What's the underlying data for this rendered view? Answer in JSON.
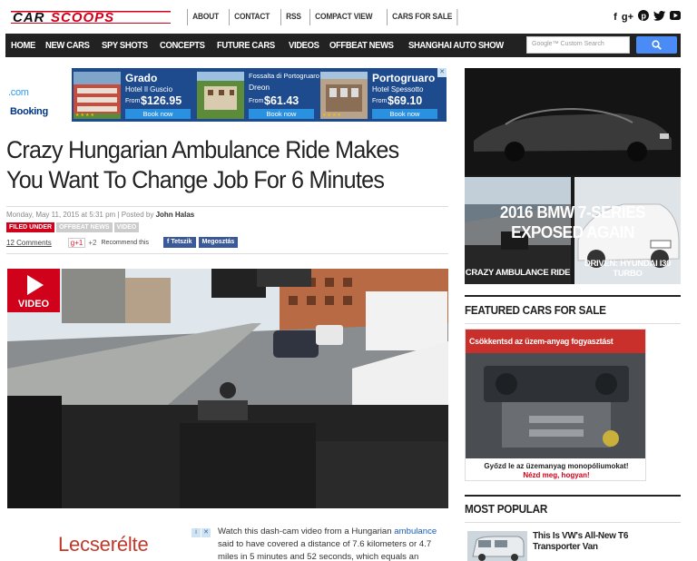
{
  "brand": {
    "name": "CARSCOOPS"
  },
  "toplinks": [
    "ABOUT",
    "CONTACT",
    "RSS",
    "COMPACT VIEW",
    "CARS FOR SALE"
  ],
  "social": [
    "f",
    "g+",
    "p",
    "t",
    "yt"
  ],
  "nav": [
    "HOME",
    "NEW CARS",
    "SPY SHOTS",
    "CONCEPTS",
    "FUTURE CARS",
    "VIDEOS",
    "OFFBEAT NEWS",
    "SHANGHAI AUTO SHOW"
  ],
  "search": {
    "placeholder": "Custom Search",
    "google": "Google™"
  },
  "ad_booking": {
    "brand_main": "Booking",
    "brand_suffix": ".com",
    "hotels": [
      {
        "city": "Grado",
        "name": "Hotel Il Guscio",
        "from": "From",
        "price": "$126.95",
        "cta": "Book now"
      },
      {
        "city": "Fossalta di Portogruaro",
        "name": "Dreon",
        "from": "From",
        "price": "$61.43",
        "cta": "Book now"
      },
      {
        "city": "Portogruaro",
        "name": "Hotel Spessotto",
        "from": "From",
        "price": "$69.10",
        "cta": "Book now"
      }
    ],
    "close": "✕"
  },
  "article": {
    "title": "Crazy Hungarian Ambulance Ride Makes You Want To Change Job For 6 Minutes",
    "date": "Monday, May 11, 2015 at 5:31 pm",
    "posted_by": "Posted by",
    "author": "John Halas",
    "tags": [
      "FILED UNDER",
      "OFFBEAT NEWS",
      "VIDEO"
    ],
    "comments": "12 Comments",
    "gplus": "g+1",
    "gplus_count": "+2",
    "recommend": "Recommend this",
    "fb_like": "Tetszik",
    "fb_share": "Megosztás",
    "video_badge": "VIDEO",
    "body_pre": "Watch this dash-cam video from a Hungarian",
    "body_link": "ambulance",
    "body_post": "said to have covered a distance of 7.6 kilometers or 4.7 miles in 5 minutes and 52 seconds, which equals an"
  },
  "inline_ad": {
    "text": "Lecserélte",
    "i": "i",
    "x": "✕"
  },
  "sidebar": {
    "feature_title_1": "2016 BMW 7-SERIES",
    "feature_title_2": "EXPOSED AGAIN",
    "thumb1": "CRAZY AMBULANCE RIDE",
    "thumb2_1": "DRIVEN: HYUNDAI I30",
    "thumb2_2": "TURBO",
    "featured_heading": "FEATURED CARS FOR SALE",
    "car_ad_top": "Csökkentsd az üzem-anyag fogyasztást",
    "car_ad_line": "Győzd le az üzemanyag monopóliumokat!",
    "car_ad_cta": "Nézd meg, hogyan!",
    "popular_heading": "MOST POPULAR",
    "popular_item": "This Is VW's All-New T6 Transporter Van"
  },
  "colors": {
    "accent": "#d0021b",
    "nav_bg": "#222222",
    "booking_blue": "#1d4b8e",
    "link": "#1a5bb5"
  }
}
